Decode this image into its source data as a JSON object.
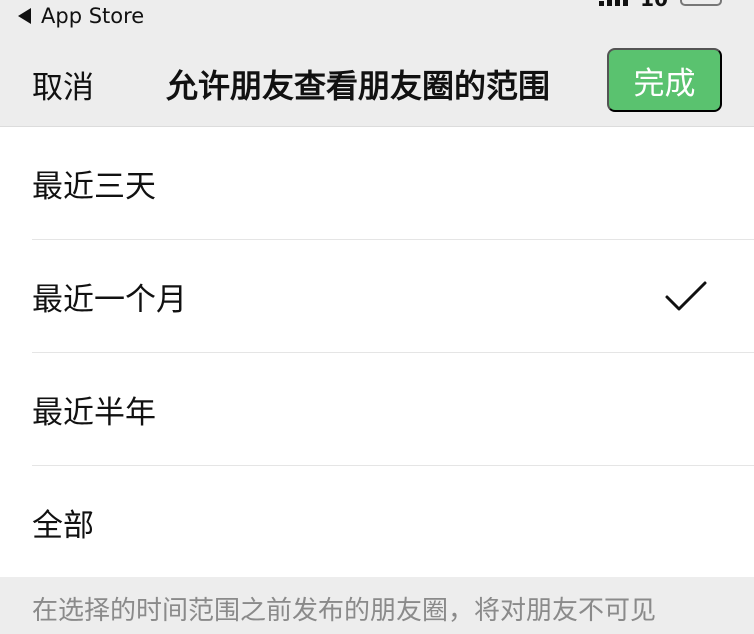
{
  "status_bar": {
    "back_label": "App Store",
    "time_partial": "10"
  },
  "nav": {
    "cancel_label": "取消",
    "title": "允许朋友查看朋友圈的范围",
    "done_label": "完成"
  },
  "options": [
    {
      "label": "最近三天",
      "selected": false
    },
    {
      "label": "最近一个月",
      "selected": true
    },
    {
      "label": "最近半年",
      "selected": false
    },
    {
      "label": "全部",
      "selected": false
    }
  ],
  "footer": {
    "note": "在选择的时间范围之前发布的朋友圈，将对朋友不可见"
  },
  "colors": {
    "accent": "#5ac26f",
    "background": "#ededed",
    "list_bg": "#ffffff",
    "footer_text": "#8a8a8a"
  },
  "icons": {
    "back": "back-triangle-icon",
    "check": "checkmark-icon"
  }
}
